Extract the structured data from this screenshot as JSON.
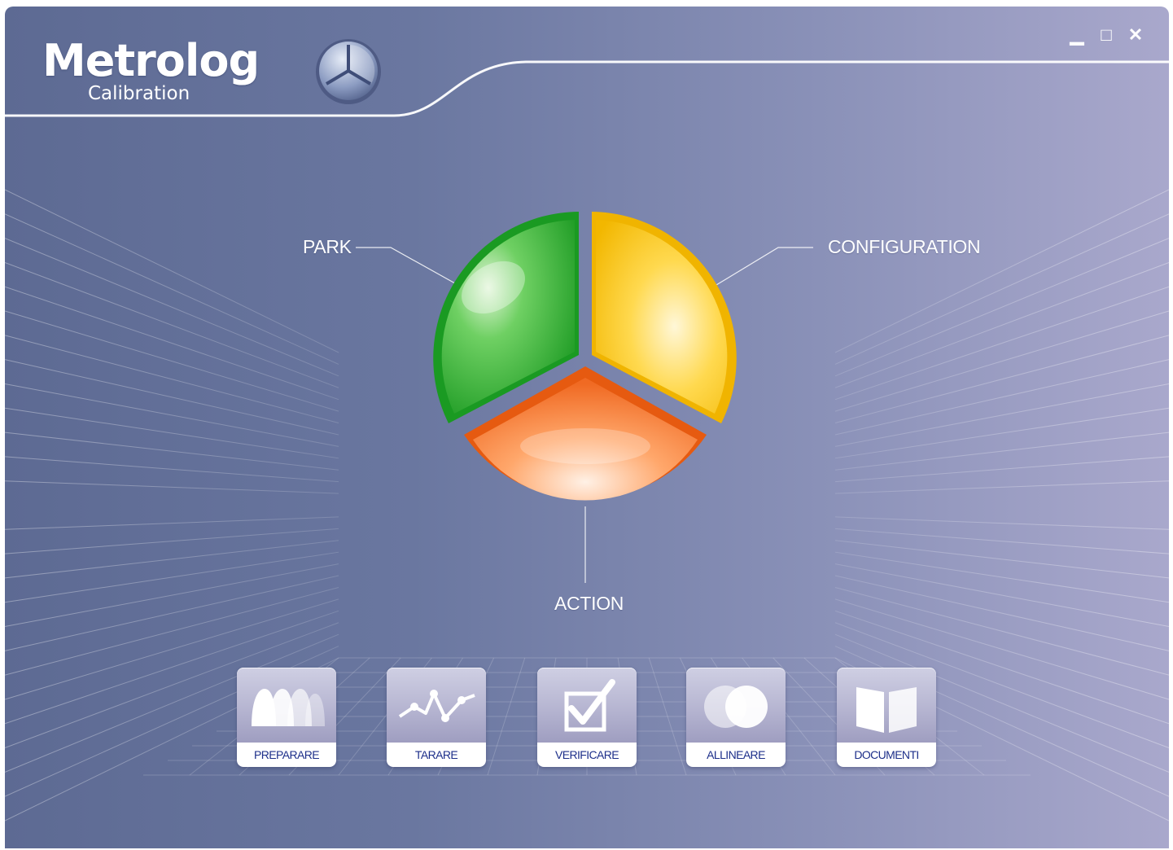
{
  "app": {
    "name": "Metrolog",
    "subtitle": "Calibration"
  },
  "window_controls": {
    "minimize": "▁",
    "maximize": "□",
    "close": "✕"
  },
  "menu_wheel": {
    "park_label": "PARK",
    "configuration_label": "CONFIGURATION",
    "action_label": "ACTION",
    "colors": {
      "park": "#27b030",
      "configuration": "#f5c419",
      "action": "#f07a35"
    }
  },
  "actions": [
    {
      "label": "PREPARARE",
      "icon": "prepare-icon"
    },
    {
      "label": "TARARE",
      "icon": "calibrate-chart-icon"
    },
    {
      "label": "VERIFICARE",
      "icon": "checkbox-check-icon"
    },
    {
      "label": "ALLINEARE",
      "icon": "align-circles-icon"
    },
    {
      "label": "DOCUMENTI",
      "icon": "book-icon"
    }
  ]
}
